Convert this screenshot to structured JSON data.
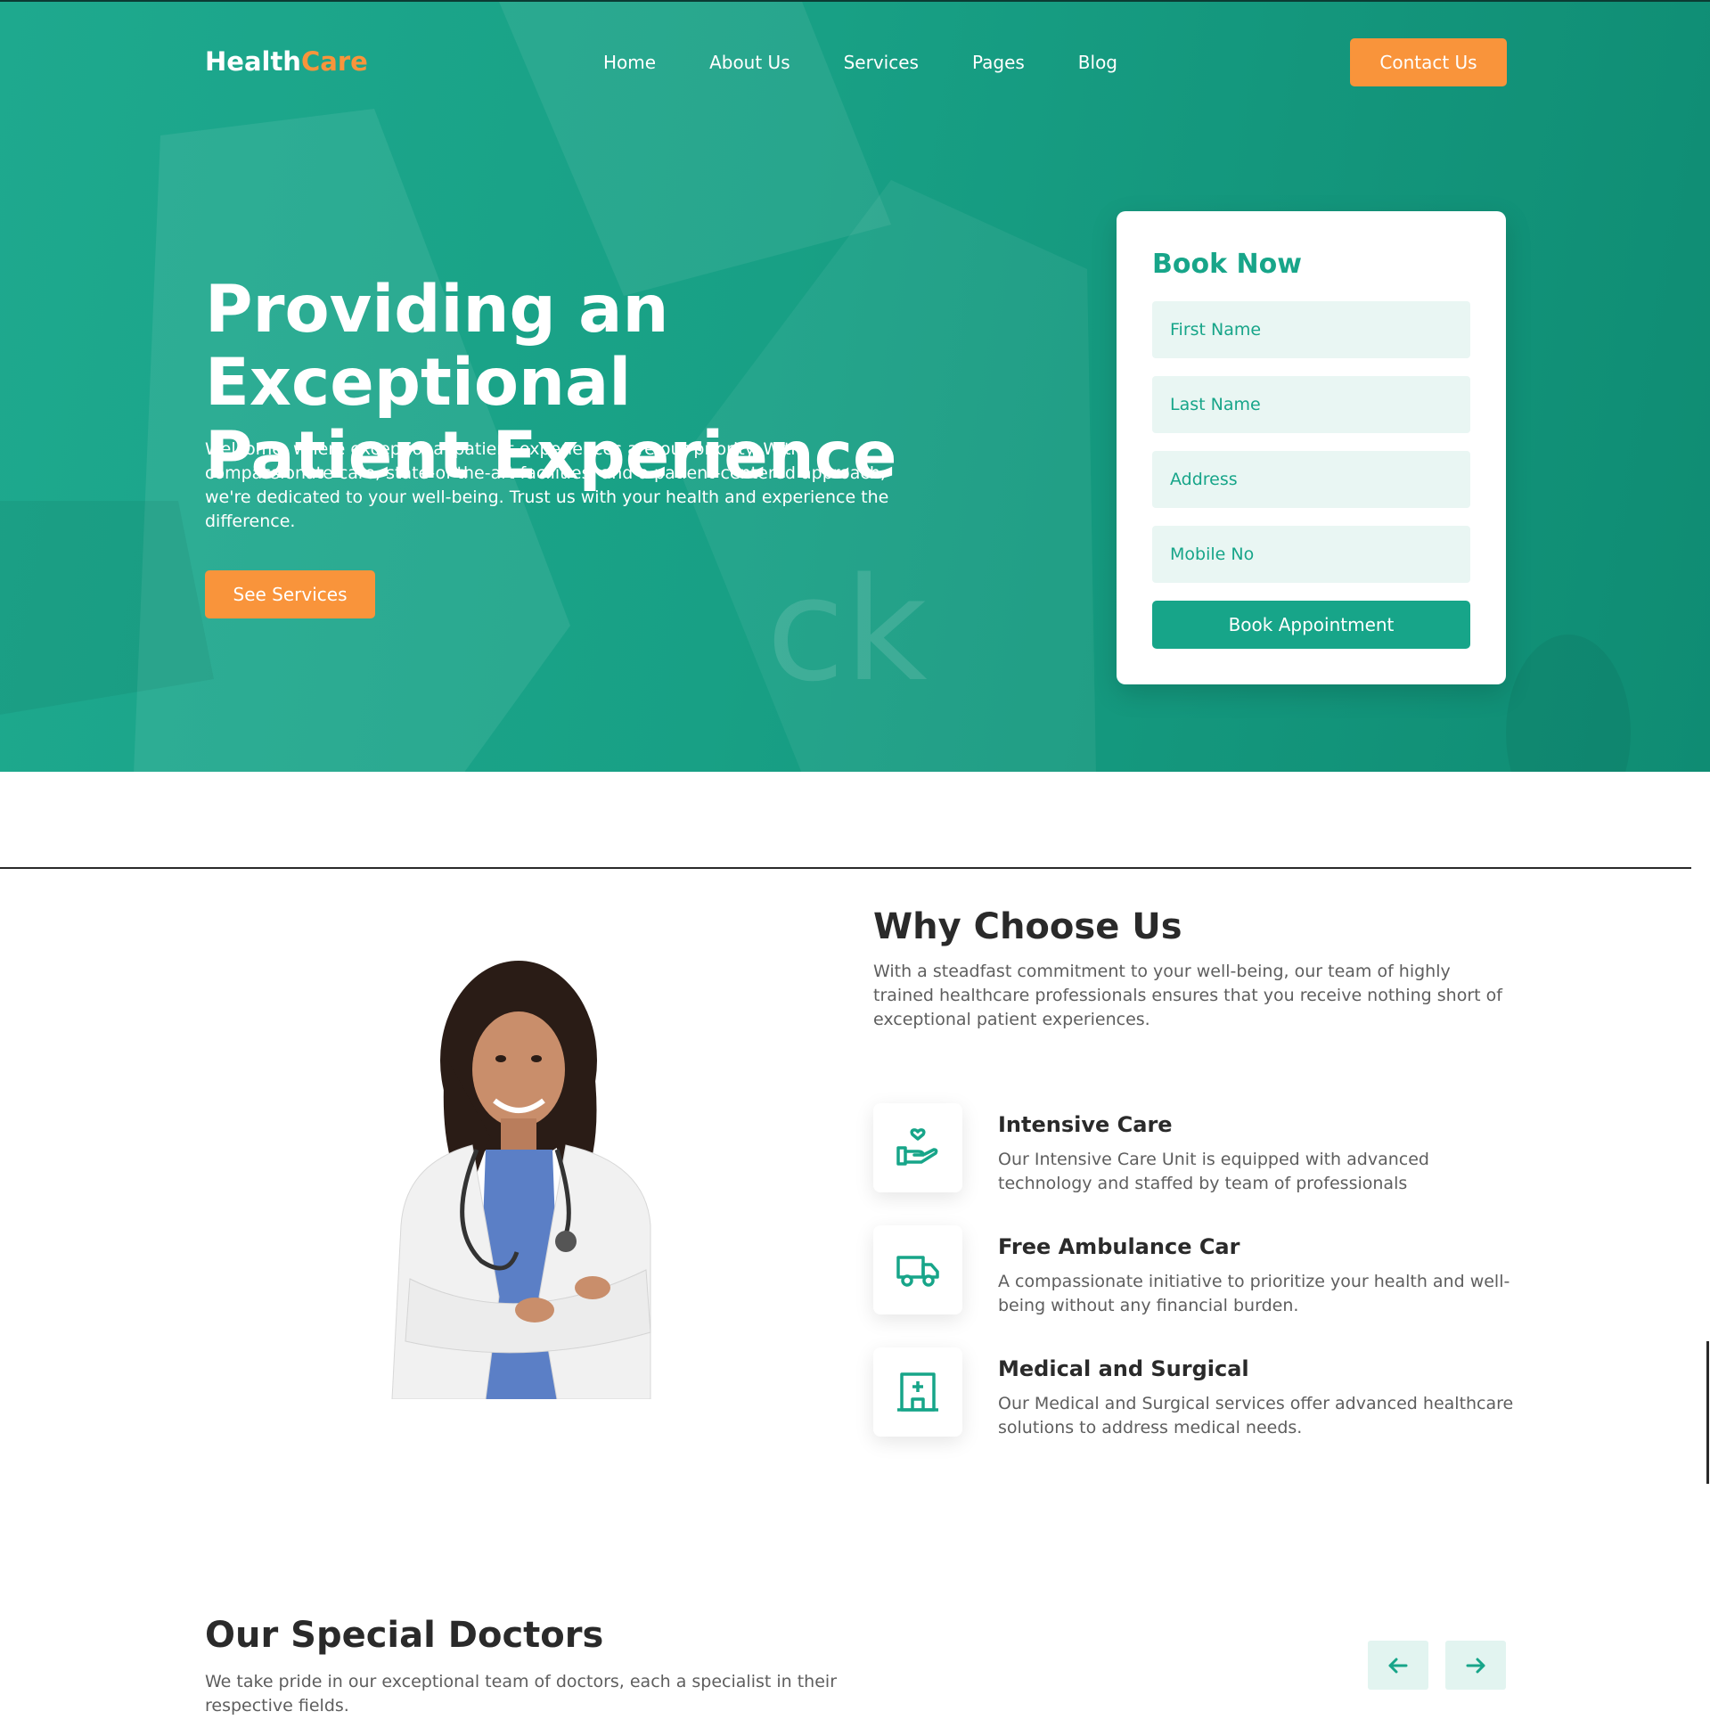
{
  "nav": {
    "logo_main": "Health",
    "logo_accent": "Care",
    "menu": [
      "Home",
      "About Us",
      "Services",
      "Pages",
      "Blog"
    ],
    "contact_label": "Contact Us"
  },
  "hero": {
    "title_line1": "Providing an Exceptional",
    "title_line2": "Patient Experience",
    "description": "Welcome, where exceptional patient experiences are our priority. With compassionate care, state-of-the-art facilities, and a patient-centered approach, we're dedicated to your well-being. Trust us with your health and experience the difference.",
    "cta_label": "See Services"
  },
  "booking": {
    "title": "Book Now",
    "fields": [
      "First Name",
      "Last Name",
      "Address",
      "Mobile No"
    ],
    "submit_label": "Book Appointment"
  },
  "why": {
    "title": "Why Choose Us",
    "description": "With a steadfast commitment to your well-being, our team of highly trained healthcare professionals ensures that you receive nothing short of exceptional patient experiences.",
    "features": [
      {
        "title": "Intensive Care",
        "description": "Our Intensive Care Unit is equipped with advanced technology and staffed by team of professionals",
        "icon": "hand-heart-icon"
      },
      {
        "title": "Free Ambulance Car",
        "description": "A compassionate initiative to prioritize your health and well-being without any financial burden.",
        "icon": "ambulance-icon"
      },
      {
        "title": "Medical and Surgical",
        "description": "Our Medical and Surgical services offer advanced healthcare solutions to address medical needs.",
        "icon": "hospital-icon"
      }
    ]
  },
  "doctors": {
    "title": "Our Special Doctors",
    "description": "We take pride in our exceptional team of doctors, each a specialist in their respective fields."
  },
  "colors": {
    "primary": "#17a589",
    "accent": "#f9943b",
    "field_bg": "#e9f6f3"
  }
}
